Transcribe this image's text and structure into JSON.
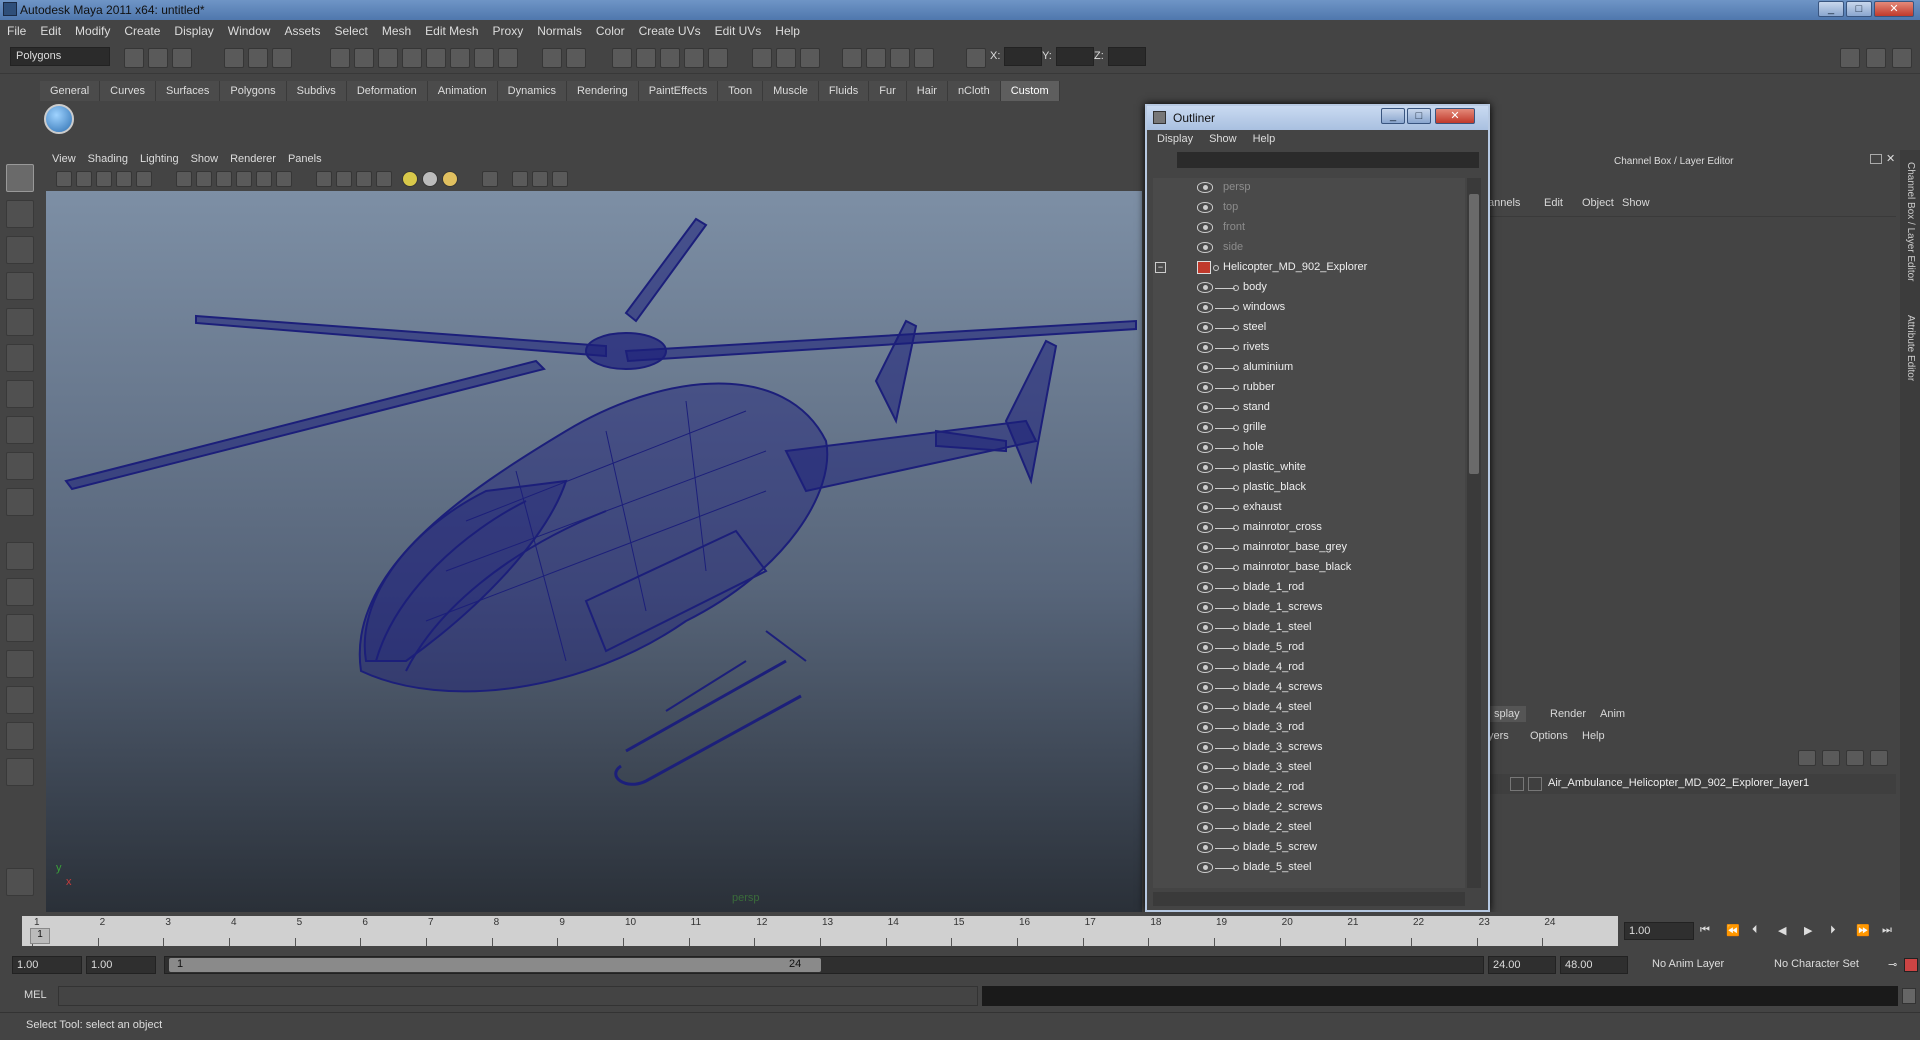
{
  "window": {
    "title": "Autodesk Maya 2011 x64: untitled*"
  },
  "menubar": [
    "File",
    "Edit",
    "Modify",
    "Create",
    "Display",
    "Window",
    "Assets",
    "Select",
    "Mesh",
    "Edit Mesh",
    "Proxy",
    "Normals",
    "Color",
    "Create UVs",
    "Edit UVs",
    "Help"
  ],
  "toolbar": {
    "mode": "Polygons",
    "x_label": "X:",
    "y_label": "Y:",
    "z_label": "Z:"
  },
  "shelf": {
    "tabs": [
      "General",
      "Curves",
      "Surfaces",
      "Polygons",
      "Subdivs",
      "Deformation",
      "Animation",
      "Dynamics",
      "Rendering",
      "PaintEffects",
      "Toon",
      "Muscle",
      "Fluids",
      "Fur",
      "Hair",
      "nCloth",
      "Custom"
    ],
    "active_tab": "Custom"
  },
  "viewport": {
    "menu": [
      "View",
      "Shading",
      "Lighting",
      "Show",
      "Renderer",
      "Panels"
    ],
    "camera": "persp",
    "axis_y": "y",
    "axis_x": "x",
    "wire_color": "#1c1f7a"
  },
  "outliner": {
    "title": "Outliner",
    "menu": [
      "Display",
      "Show",
      "Help"
    ],
    "cameras": [
      "persp",
      "top",
      "front",
      "side"
    ],
    "root": "Helicopter_MD_902_Explorer",
    "children": [
      "body",
      "windows",
      "steel",
      "rivets",
      "aluminium",
      "rubber",
      "stand",
      "grille",
      "hole",
      "plastic_white",
      "plastic_black",
      "exhaust",
      "mainrotor_cross",
      "mainrotor_base_grey",
      "mainrotor_base_black",
      "blade_1_rod",
      "blade_1_screws",
      "blade_1_steel",
      "blade_5_rod",
      "blade_4_rod",
      "blade_4_screws",
      "blade_4_steel",
      "blade_3_rod",
      "blade_3_screws",
      "blade_3_steel",
      "blade_2_rod",
      "blade_2_screws",
      "blade_2_steel",
      "blade_5_screw",
      "blade_5_steel"
    ]
  },
  "channelbox": {
    "title": "Channel Box / Layer Editor",
    "menu": [
      "annels",
      "Edit",
      "Object",
      "Show"
    ],
    "side_tab_1": "Channel Box / Layer Editor",
    "side_tab_2": "Attribute Editor"
  },
  "layers": {
    "tabs": [
      "splay",
      "Render",
      "Anim"
    ],
    "menu": [
      "yers",
      "Options",
      "Help"
    ],
    "layer_name": "Air_Ambulance_Helicopter_MD_902_Explorer_layer1"
  },
  "timeslider": {
    "ticks": [
      "1",
      "2",
      "3",
      "4",
      "5",
      "6",
      "7",
      "8",
      "9",
      "10",
      "11",
      "12",
      "13",
      "14",
      "15",
      "16",
      "17",
      "18",
      "19",
      "20",
      "21",
      "22",
      "23",
      "24"
    ],
    "current_frame": "1",
    "current_time_field": "1.00"
  },
  "range": {
    "start": "1.00",
    "start2": "1.00",
    "inner_start": "1",
    "inner_end": "24",
    "end": "24.00",
    "end2": "48.00",
    "anim_layer": "No Anim Layer",
    "char_set": "No Character Set"
  },
  "cmdline": {
    "label": "MEL"
  },
  "helpline": {
    "text": "Select Tool: select an object"
  }
}
